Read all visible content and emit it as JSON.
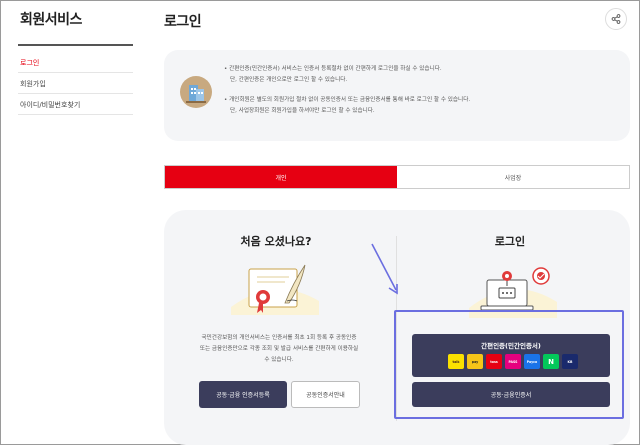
{
  "sidebar": {
    "title": "회원서비스",
    "items": [
      {
        "label": "로그인",
        "active": true
      },
      {
        "label": "회원가입",
        "active": false
      },
      {
        "label": "아이디/비밀번호찾기",
        "active": false
      }
    ]
  },
  "header": {
    "title": "로그인",
    "share_icon": "share-icon"
  },
  "info": {
    "lines_a": [
      "•  간편인증(민간인증서) 서비스는 인증서 등록절차 없이 간편하게 로그인을 하실 수 있습니다.",
      "단, 간편인증은 개인으로만 로그인 할 수 있습니다."
    ],
    "lines_b": [
      "•  개인회원은 별도의 회원가입 절차 없이 공동인증서 또는 금융인증서를 통해 바로 로그인 할 수 있습니다.",
      "단, 사업장회원은 회원가입을 하셔야만 로그인 할 수 있습니다."
    ]
  },
  "tabs": [
    {
      "label": "개인",
      "active": true
    },
    {
      "label": "사업장",
      "active": false
    }
  ],
  "first_visit": {
    "title": "처음 오셨나요?",
    "description_lines": [
      "국민건강보험의 개인서비스는 인증서를 최초 1회 등록 후 공동인증",
      "또는 금융인증만으로 각종 조회 및 발급 서비스를 간편하게 이용하실",
      "수 있습니다."
    ],
    "register_button": "공동·금융 인증서등록",
    "guide_button": "공동인증서안내"
  },
  "login": {
    "title": "로그인",
    "simple_auth_button": "간편인증(민간인증서)",
    "providers": [
      {
        "name": "talk",
        "color": "#fae100",
        "text_color": "#3c1e1e"
      },
      {
        "name": "pay",
        "color": "#f5c518",
        "text_color": "#222222"
      },
      {
        "name": "toss",
        "color": "#e60012",
        "text_color": "#ffffff"
      },
      {
        "name": "PASS",
        "color": "#e6007e",
        "text_color": "#ffffff"
      },
      {
        "name": "Payco",
        "color": "#1a73e8",
        "text_color": "#ffffff"
      },
      {
        "name": "N",
        "color": "#03c75a",
        "text_color": "#ffffff"
      },
      {
        "name": "KB",
        "color": "#1a2a6c",
        "text_color": "#ffffff"
      }
    ],
    "joint_cert_button": "공동·금융인증서"
  },
  "colors": {
    "accent": "#e60012",
    "button_dark": "#3b3d5c",
    "highlight": "#6b6ee0"
  }
}
